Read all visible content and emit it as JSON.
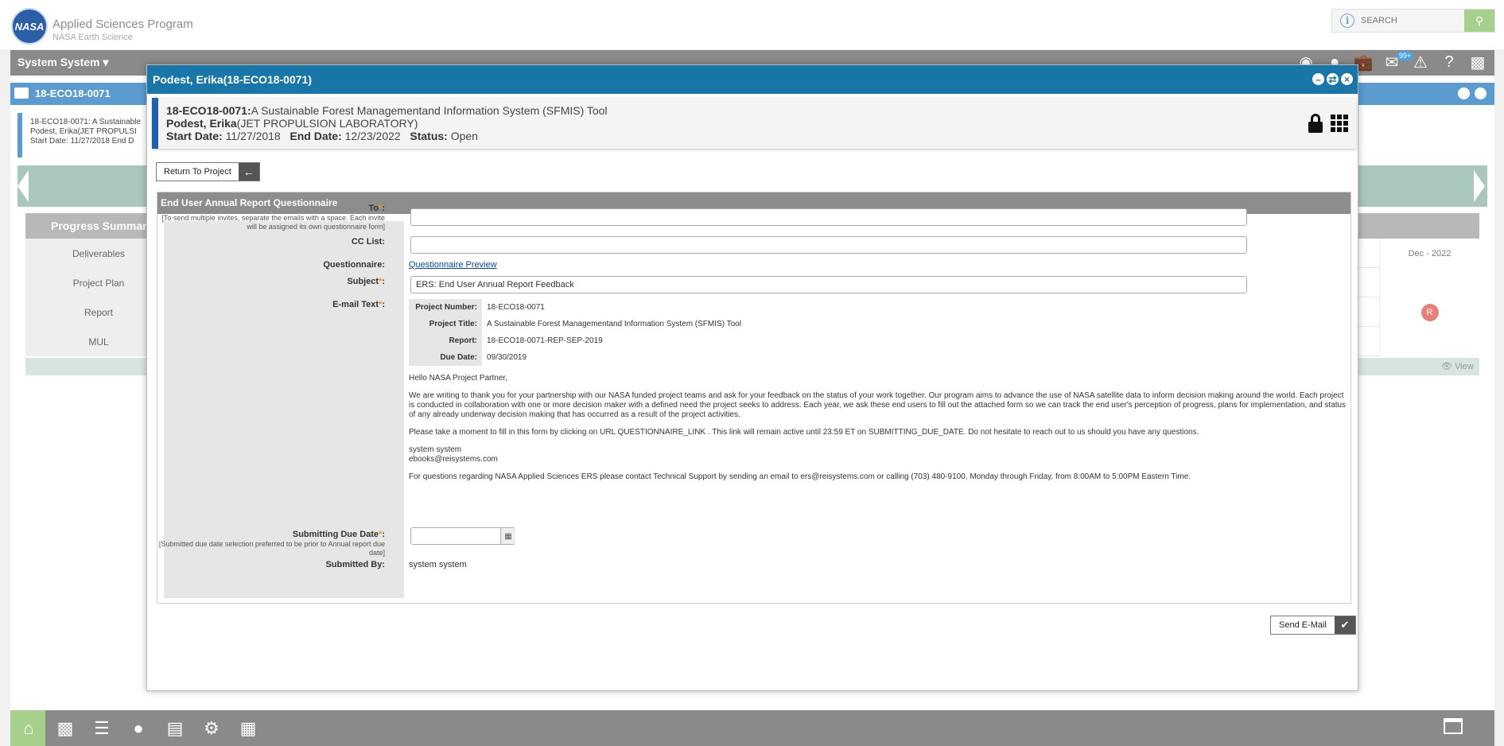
{
  "header": {
    "logo_text": "NASA",
    "brand_title": "Applied Sciences Program",
    "brand_subtitle": "NASA Earth Science",
    "search_placeholder": "SEARCH"
  },
  "sysbar": {
    "label": "System System ▾",
    "badge": "99+"
  },
  "project_bar": {
    "label": "18-ECO18-0071"
  },
  "project_card": {
    "line1": "18-ECO18-0071: A Sustainable",
    "line2": "Podest, Erika(JET PROPULSI",
    "line3": "Start Date: 11/27/2018 End D"
  },
  "progress_summary": {
    "title": "Progress Summary",
    "rows": [
      "Deliverables",
      "Project Plan",
      "Report",
      "MUL"
    ],
    "right_header": "Dec - 2022",
    "report_badge": "R",
    "view_label": "View"
  },
  "modal": {
    "title": "Podest, Erika(18-ECO18-0071)",
    "card": {
      "project_number": "18-ECO18-0071:",
      "project_title": "A Sustainable Forest Managementand Information System (SFMIS) Tool",
      "pi_name": "Podest, Erika",
      "pi_org": "(JET PROPULSION LABORATORY)",
      "start_label": "Start Date:",
      "start_value": "11/27/2018",
      "end_label": "End Date:",
      "end_value": "12/23/2022",
      "status_label": "Status:",
      "status_value": "Open"
    },
    "return_button": "Return To Project",
    "section_title": "End User Annual Report Questionnaire",
    "form": {
      "to_label": "To",
      "to_note": "[To send multiple invites, separate the emails with a space. Each invite will be assigned its own questionnaire form]",
      "to_value": "",
      "cc_label": "CC List:",
      "cc_value": "",
      "questionnaire_label": "Questionnaire:",
      "questionnaire_link": "Questionnaire Preview",
      "subject_label": "Subject",
      "subject_value": "ERS: End User Annual Report Feedback",
      "email_text_label": "E-mail Text",
      "email": {
        "fields": [
          {
            "k": "Project Number:",
            "v": "18-ECO18-0071"
          },
          {
            "k": "Project Title:",
            "v": "A Sustainable Forest Managementand Information System (SFMIS) Tool"
          },
          {
            "k": "Report:",
            "v": "18-ECO18-0071-REP-SEP-2019"
          },
          {
            "k": "Due Date:",
            "v": "09/30/2019"
          }
        ],
        "greeting": "Hello NASA Project Partner,",
        "para1": "We are writing to thank you for your partnership with our NASA funded project teams and ask for your feedback on the status of your work together. Our program aims to advance the use of NASA satellite data to inform decision making around the world. Each project is conducted in collaboration with one or more decision maker with a defined need the project seeks to address. Each year, we ask these end users to fill out the attached form so we can track the end user's perception of progress, plans for implementation, and status of any already underway decision making that has occurred as a result of the project activities.",
        "para2": "Please take a moment to fill in this form by clicking on URL QUESTIONNAIRE_LINK . This link will remain active until 23:59 ET on SUBMITTING_DUE_DATE. Do not hesitate to reach out to us should you have any questions.",
        "sign_name": "system system",
        "sign_email": "ebooks@reisystems.com",
        "para3": "For questions regarding NASA Applied Sciences ERS please contact Technical Support by sending an email to ers@reisystems.com or calling (703) 480-9100, Monday through Friday, from 8:00AM to 5:00PM Eastern Time."
      },
      "due_label": "Submitting Due Date",
      "due_note": "[Submitted due date selection preferred to be prior to Annual report due date]",
      "due_value": "",
      "submitted_by_label": "Submitted By:",
      "submitted_by_value": "system system"
    },
    "send_button": "Send E-Mail"
  }
}
